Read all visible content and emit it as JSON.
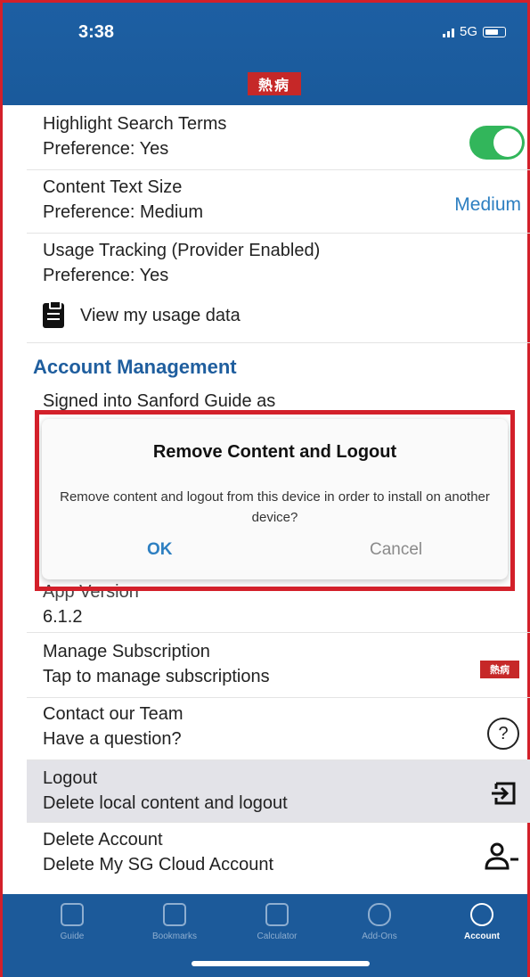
{
  "status": {
    "time": "3:38",
    "network": "5G"
  },
  "header": {
    "logo_text": "熱病"
  },
  "settings": {
    "highlight": {
      "title": "Highlight Search Terms",
      "pref": "Preference: Yes"
    },
    "text_size": {
      "title": "Content Text Size",
      "pref": "Preference: Medium",
      "value": "Medium"
    },
    "tracking": {
      "title": "Usage Tracking (Provider Enabled)",
      "pref": "Preference: Yes"
    },
    "usage_link": "View my usage data"
  },
  "account": {
    "section_title": "Account Management",
    "signed_in": "Signed into Sanford Guide as",
    "app_version_label": "App Version",
    "app_version_value": "6.1.2",
    "manage": {
      "title": "Manage Subscription",
      "sub": "Tap to manage subscriptions"
    },
    "contact": {
      "title": "Contact our Team",
      "sub": "Have a question?"
    },
    "logout": {
      "title": "Logout",
      "sub": "Delete local content and logout"
    },
    "delete": {
      "title": "Delete Account",
      "sub": "Delete My SG Cloud Account"
    }
  },
  "dialog": {
    "title": "Remove Content and Logout",
    "message": "Remove content and logout from this device in order to install on another device?",
    "ok": "OK",
    "cancel": "Cancel"
  },
  "tabs": [
    "Guide",
    "Bookmarks",
    "Calculator",
    "Add-Ons",
    "Account"
  ],
  "colors": {
    "header": "#1d5fa3",
    "accent": "#2d7fc1",
    "toggle_on": "#32b65b",
    "highlight": "#d3202a"
  }
}
